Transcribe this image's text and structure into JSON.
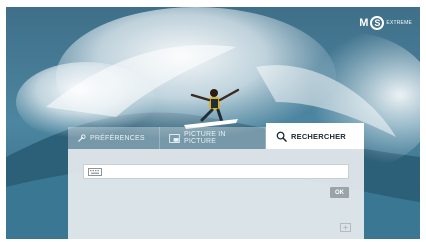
{
  "brand": {
    "logo_mark": "M",
    "logo_circle": "S",
    "logo_sub": "EXTREME"
  },
  "tabs": [
    {
      "label": "PRÉFÉRENCES",
      "icon": "wrench-icon",
      "active": false
    },
    {
      "label": "PICTURE IN PICTURE",
      "icon": "pip-icon",
      "active": false
    },
    {
      "label": "RECHERCHER",
      "icon": "search-icon",
      "active": true
    }
  ],
  "search": {
    "value": "",
    "placeholder": "",
    "keyboard_icon": "keyboard-icon",
    "ok_label": "OK"
  },
  "colors": {
    "active_tab_bg": "#ffffff",
    "panel_bg": "#ecf0f2",
    "ok_bg": "#9aa3a8"
  }
}
